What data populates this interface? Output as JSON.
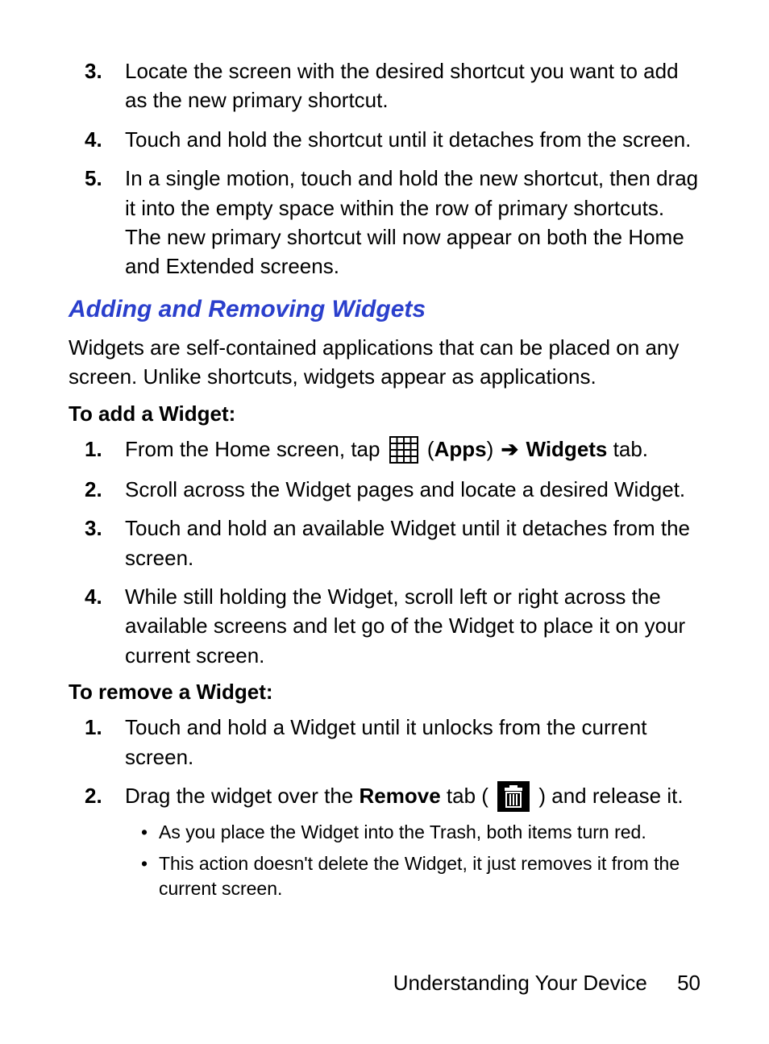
{
  "top_list": {
    "items": [
      {
        "num": "3.",
        "text": "Locate the screen with the desired shortcut you want to add as the new primary shortcut."
      },
      {
        "num": "4.",
        "text": "Touch and hold the shortcut until it detaches from the screen."
      },
      {
        "num": "5.",
        "text": "In a single motion, touch and hold the new shortcut, then drag it into the empty space within the row of primary shortcuts. The new primary shortcut will now appear on both the Home and Extended screens."
      }
    ]
  },
  "section": {
    "heading": "Adding and Removing Widgets",
    "intro": "Widgets are self-contained applications that can be placed on any screen. Unlike shortcuts, widgets appear as applications."
  },
  "add": {
    "heading": "To add a Widget:",
    "item1": {
      "num": "1.",
      "prefix": "From the Home screen, tap ",
      "open_paren": " (",
      "apps_label": "Apps",
      "close_paren": ") ",
      "arrow": "➔",
      "widgets_label": " Widgets",
      "suffix": " tab."
    },
    "item2": {
      "num": "2.",
      "text": "Scroll across the Widget pages and locate a desired Widget."
    },
    "item3": {
      "num": "3.",
      "text": "Touch and hold an available Widget until it detaches from the screen."
    },
    "item4": {
      "num": "4.",
      "text": "While still holding the Widget, scroll left or right across the available screens and let go of the Widget to place it on your current screen."
    }
  },
  "remove": {
    "heading": "To remove a Widget:",
    "item1": {
      "num": "1.",
      "text": "Touch and hold a Widget until it unlocks from the current screen."
    },
    "item2": {
      "num": "2.",
      "prefix": "Drag the widget over the ",
      "remove_label": "Remove",
      "mid": " tab (",
      "close": ") and release it."
    },
    "sub": [
      "As you place the Widget into the Trash, both items turn red.",
      "This action doesn't delete the Widget, it just removes it from the current screen."
    ]
  },
  "footer": {
    "title": "Understanding Your Device",
    "page": "50"
  }
}
